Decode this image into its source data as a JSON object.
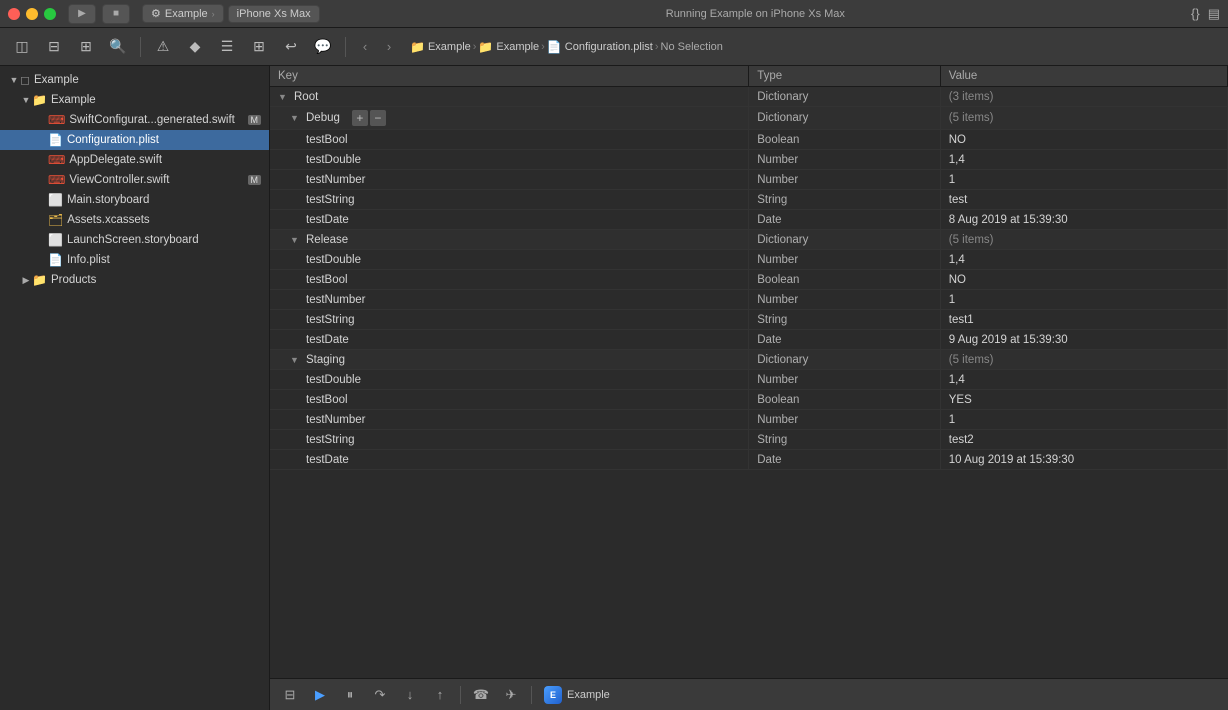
{
  "titlebar": {
    "scheme": "Example",
    "device": "iPhone Xs Max",
    "status": "Running Example on iPhone Xs Max",
    "buttons": {
      "close": "●",
      "min": "●",
      "max": "●"
    }
  },
  "toolbar": {
    "breadcrumb": [
      {
        "icon": "📁",
        "label": "Example",
        "type": "folder"
      },
      {
        "icon": "📁",
        "label": "Example",
        "type": "folder"
      },
      {
        "icon": "📄",
        "label": "Configuration.plist",
        "type": "plist"
      },
      {
        "label": "No Selection",
        "type": "text"
      }
    ]
  },
  "sidebar": {
    "items": [
      {
        "id": "example-group",
        "label": "Example",
        "type": "group",
        "indent": 0,
        "expanded": true,
        "icon": "group"
      },
      {
        "id": "example-folder",
        "label": "Example",
        "type": "folder",
        "indent": 1,
        "expanded": true,
        "icon": "folder"
      },
      {
        "id": "swiftconfig",
        "label": "SwiftConfigurat...generated.swift",
        "type": "swift",
        "indent": 2,
        "badge": "M"
      },
      {
        "id": "configuration",
        "label": "Configuration.plist",
        "type": "plist",
        "indent": 2
      },
      {
        "id": "appdelegate",
        "label": "AppDelegate.swift",
        "type": "swift",
        "indent": 2
      },
      {
        "id": "viewcontroller",
        "label": "ViewController.swift",
        "type": "swift",
        "indent": 2,
        "badge": "M"
      },
      {
        "id": "mainstoryboard",
        "label": "Main.storyboard",
        "type": "storyboard",
        "indent": 2
      },
      {
        "id": "assets",
        "label": "Assets.xcassets",
        "type": "assets",
        "indent": 2
      },
      {
        "id": "launchscreen",
        "label": "LaunchScreen.storyboard",
        "type": "storyboard",
        "indent": 2
      },
      {
        "id": "infoplist",
        "label": "Info.plist",
        "type": "plist",
        "indent": 2
      },
      {
        "id": "products",
        "label": "Products",
        "type": "folder",
        "indent": 1,
        "expanded": false,
        "icon": "folder"
      }
    ]
  },
  "plist": {
    "columns": {
      "key": "Key",
      "type": "Type",
      "value": "Value"
    },
    "rows": [
      {
        "id": "root",
        "key": "Root",
        "type": "Dictionary",
        "value": "(3 items)",
        "indent": 0,
        "expanded": true,
        "arrow": "▼"
      },
      {
        "id": "debug",
        "key": "Debug",
        "type": "Dictionary",
        "value": "(5 items)",
        "indent": 1,
        "expanded": true,
        "arrow": "▼",
        "hasAddRemove": true
      },
      {
        "id": "debug-testBool",
        "key": "testBool",
        "type": "Boolean",
        "value": "NO",
        "indent": 2
      },
      {
        "id": "debug-testDouble",
        "key": "testDouble",
        "type": "Number",
        "value": "1,4",
        "indent": 2
      },
      {
        "id": "debug-testNumber",
        "key": "testNumber",
        "type": "Number",
        "value": "1",
        "indent": 2
      },
      {
        "id": "debug-testString",
        "key": "testString",
        "type": "String",
        "value": "test",
        "indent": 2
      },
      {
        "id": "debug-testDate",
        "key": "testDate",
        "type": "Date",
        "value": "8 Aug 2019 at 15:39:30",
        "indent": 2
      },
      {
        "id": "release",
        "key": "Release",
        "type": "Dictionary",
        "value": "(5 items)",
        "indent": 1,
        "expanded": true,
        "arrow": "▼"
      },
      {
        "id": "release-testDouble",
        "key": "testDouble",
        "type": "Number",
        "value": "1,4",
        "indent": 2
      },
      {
        "id": "release-testBool",
        "key": "testBool",
        "type": "Boolean",
        "value": "NO",
        "indent": 2
      },
      {
        "id": "release-testNumber",
        "key": "testNumber",
        "type": "Number",
        "value": "1",
        "indent": 2
      },
      {
        "id": "release-testString",
        "key": "testString",
        "type": "String",
        "value": "test1",
        "indent": 2
      },
      {
        "id": "release-testDate",
        "key": "testDate",
        "type": "Date",
        "value": "9 Aug 2019 at 15:39:30",
        "indent": 2
      },
      {
        "id": "staging",
        "key": "Staging",
        "type": "Dictionary",
        "value": "(5 items)",
        "indent": 1,
        "expanded": true,
        "arrow": "▼"
      },
      {
        "id": "staging-testDouble",
        "key": "testDouble",
        "type": "Number",
        "value": "1,4",
        "indent": 2
      },
      {
        "id": "staging-testBool",
        "key": "testBool",
        "type": "Boolean",
        "value": "YES",
        "indent": 2
      },
      {
        "id": "staging-testNumber",
        "key": "testNumber",
        "type": "Number",
        "value": "1",
        "indent": 2
      },
      {
        "id": "staging-testString",
        "key": "testString",
        "type": "String",
        "value": "test2",
        "indent": 2
      },
      {
        "id": "staging-testDate",
        "key": "testDate",
        "type": "Date",
        "value": "10 Aug 2019 at 15:39:30",
        "indent": 2
      }
    ]
  },
  "bottombar": {
    "app_label": "Example",
    "buttons": [
      "debug-view",
      "run-play",
      "pause",
      "step-over",
      "step-into",
      "step-out",
      "simulate",
      "breakpoints",
      "share"
    ]
  },
  "colors": {
    "sidebar_bg": "#2b2b2b",
    "toolbar_bg": "#3a3a3a",
    "selected": "#3d6a9e",
    "row_border": "#333333"
  }
}
